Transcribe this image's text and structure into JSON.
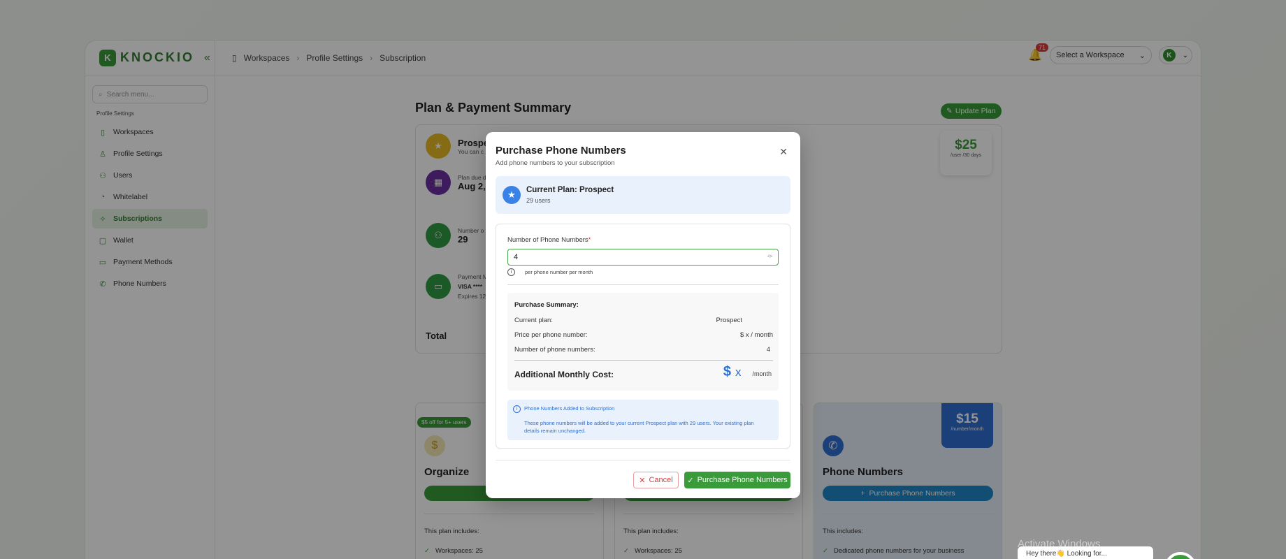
{
  "topbar": {
    "logo_letter": "K",
    "logo_text": "KNOCKIO",
    "collapse_icon": "«",
    "breadcrumbs": [
      "Workspaces",
      "Profile Settings",
      "Subscription"
    ],
    "notification_count": "71",
    "workspace_select": "Select a Workspace",
    "avatar_letter": "K"
  },
  "sidebar": {
    "search_placeholder": "Search menu...",
    "caption": "Profile Settings",
    "items": [
      {
        "label": "Workspaces",
        "icon": "building-icon"
      },
      {
        "label": "Profile Settings",
        "icon": "user-icon"
      },
      {
        "label": "Users",
        "icon": "users-icon"
      },
      {
        "label": "Whitelabel",
        "icon": "palette-icon"
      },
      {
        "label": "Subscriptions",
        "icon": "sparkle-icon",
        "active": true
      },
      {
        "label": "Wallet",
        "icon": "wallet-icon"
      },
      {
        "label": "Payment Methods",
        "icon": "card-icon"
      },
      {
        "label": "Phone Numbers",
        "icon": "phone-icon"
      }
    ]
  },
  "main": {
    "page_title": "Plan & Payment Summary",
    "update_plan": "Update Plan",
    "summary": {
      "plan_name_partial": "Prospe",
      "plan_sub_partial": "You can c",
      "due_label_partial": "Plan due d",
      "due_value_partial": "Aug 2,",
      "users_label_partial": "Number o",
      "users_value": "29",
      "payment_label_partial": "Payment M",
      "card_mask": "VISA ****",
      "expires_partial": "Expires 12/",
      "total_label": "Total",
      "price": "$25",
      "price_unit": "/user /30 days"
    },
    "plans": [
      {
        "promo": "$5 off for 5+ users",
        "name": "Organize",
        "includes": "This plan includes:",
        "feature": "Workspaces: 25"
      },
      {
        "includes": "This plan includes:",
        "feature": "Workspaces: 25"
      },
      {
        "name": "Phone Numbers",
        "price": "$15",
        "price_unit": "/number/month",
        "button": "Purchase Phone Numbers",
        "includes": "This includes:",
        "feature": "Dedicated phone numbers for your business"
      }
    ]
  },
  "modal": {
    "title": "Purchase Phone Numbers",
    "subtitle": "Add phone numbers to your subscription",
    "current_plan_title": "Current Plan: Prospect",
    "current_plan_users": "29 users",
    "field_label": "Number of Phone Numbers",
    "field_required": "*",
    "field_value": "4",
    "hint": "per phone number per month",
    "summary_title": "Purchase Summary:",
    "rows": [
      {
        "label": "Current plan:",
        "value": "Prospect"
      },
      {
        "label": "Price per phone number:",
        "value": "$ x / month"
      },
      {
        "label": "Number of phone numbers:",
        "value": "4"
      }
    ],
    "amc_label": "Additional Monthly Cost:",
    "amc_currency": "$",
    "amc_value": "x",
    "amc_unit": "/month",
    "info_title": "Phone Numbers Added to Subscription",
    "info_text": "These phone numbers will be added to your current Prospect plan with 29 users. Your existing plan details remain unchanged.",
    "cancel": "Cancel",
    "purchase": "Purchase Phone Numbers"
  },
  "windows": {
    "watermark": "Activate Windows",
    "toast": "Hey there👋 Looking for..."
  },
  "colors": {
    "brand_green": "#3a9b3a",
    "accent_blue": "#2f6fd0",
    "danger": "#d83a3a"
  }
}
